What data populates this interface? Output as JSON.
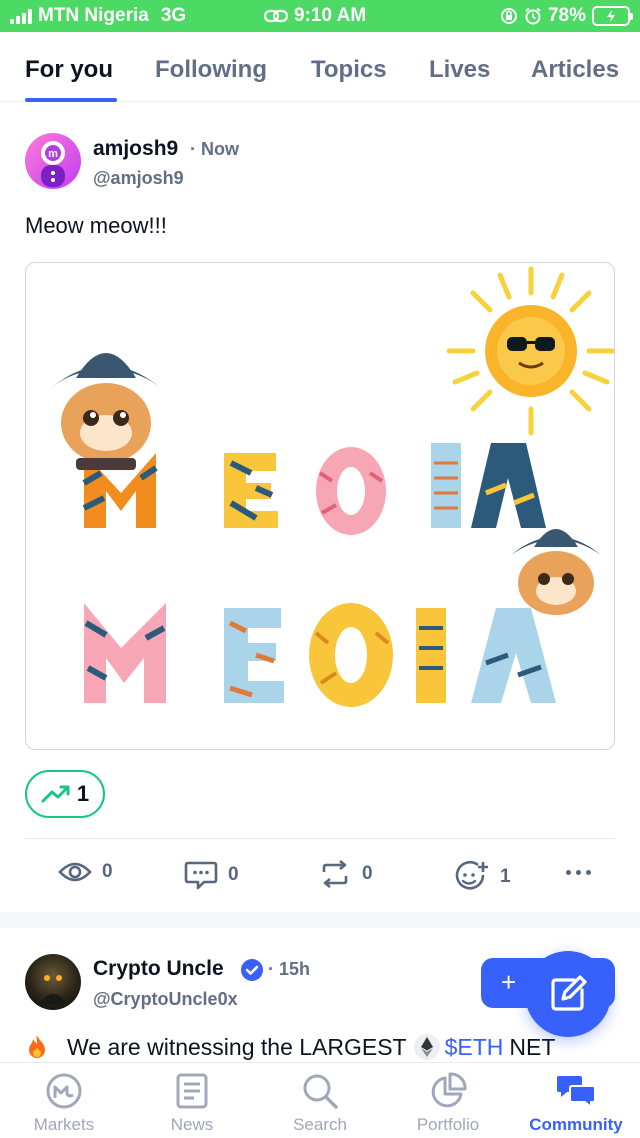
{
  "status_bar": {
    "carrier": "MTN Nigeria",
    "network": "3G",
    "time": "9:10 AM",
    "battery": "78%"
  },
  "tabs": [
    {
      "label": "For you",
      "active": true
    },
    {
      "label": "Following",
      "active": false
    },
    {
      "label": "Topics",
      "active": false
    },
    {
      "label": "Lives",
      "active": false
    },
    {
      "label": "Articles",
      "active": false
    }
  ],
  "post1": {
    "author": "amjosh9",
    "time": "· Now",
    "handle": "@amjosh9",
    "text": "Meow meow!!!",
    "bullish_count": "1",
    "actions": {
      "views": "0",
      "comments": "0",
      "reposts": "0",
      "reactions": "1"
    }
  },
  "post2": {
    "author": "Crypto Uncle",
    "time": "· 15h",
    "handle": "@CryptoUncle0x",
    "text_prefix": "We are witnessing the LARGEST",
    "ticker": "$ETH",
    "text_suffix": "NET",
    "fab_plus": "+"
  },
  "bottom_nav": [
    {
      "label": "Markets",
      "icon": "markets-icon",
      "active": false
    },
    {
      "label": "News",
      "icon": "news-icon",
      "active": false
    },
    {
      "label": "Search",
      "icon": "search-icon",
      "active": false
    },
    {
      "label": "Portfolio",
      "icon": "portfolio-icon",
      "active": false
    },
    {
      "label": "Community",
      "icon": "community-icon",
      "active": true
    }
  ],
  "colors": {
    "accent": "#3861fb",
    "status_green": "#4cd964",
    "bullish": "#16c784",
    "muted": "#616e85"
  }
}
